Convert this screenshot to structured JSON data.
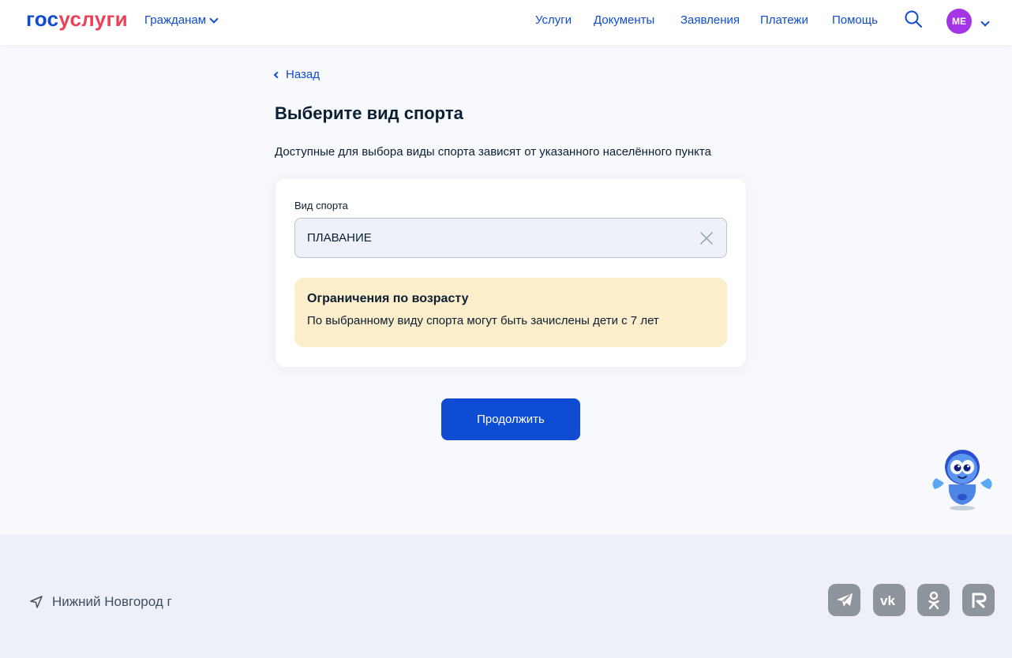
{
  "header": {
    "logo_part1": "гос",
    "logo_part2": "услуги",
    "citizens_label": "Гражданам",
    "nav": [
      "Услуги",
      "Документы",
      "Заявления",
      "Платежи",
      "Помощь"
    ],
    "avatar_initials": "ME"
  },
  "main": {
    "back_label": "Назад",
    "title": "Выберите вид спорта",
    "subtitle": "Доступные для выбора виды спорта зависят от указанного населённого пункта",
    "field_label": "Вид спорта",
    "field_value": "ПЛАВАНИЕ",
    "notice_title": "Ограничения по возрасту",
    "notice_text": "По выбранному виду спорта могут быть зачислены дети с 7 лет",
    "continue_label": "Продолжить"
  },
  "footer": {
    "location": "Нижний Новгород г",
    "social": [
      "telegram-icon",
      "vk-icon",
      "odnoklassniki-icon",
      "rutube-icon"
    ]
  },
  "colors": {
    "brand_blue": "#0d4cd3",
    "brand_red": "#ee3f58",
    "avatar": "#a434e6",
    "notice_bg": "#fdeecb",
    "social_bg": "#8e949b"
  }
}
